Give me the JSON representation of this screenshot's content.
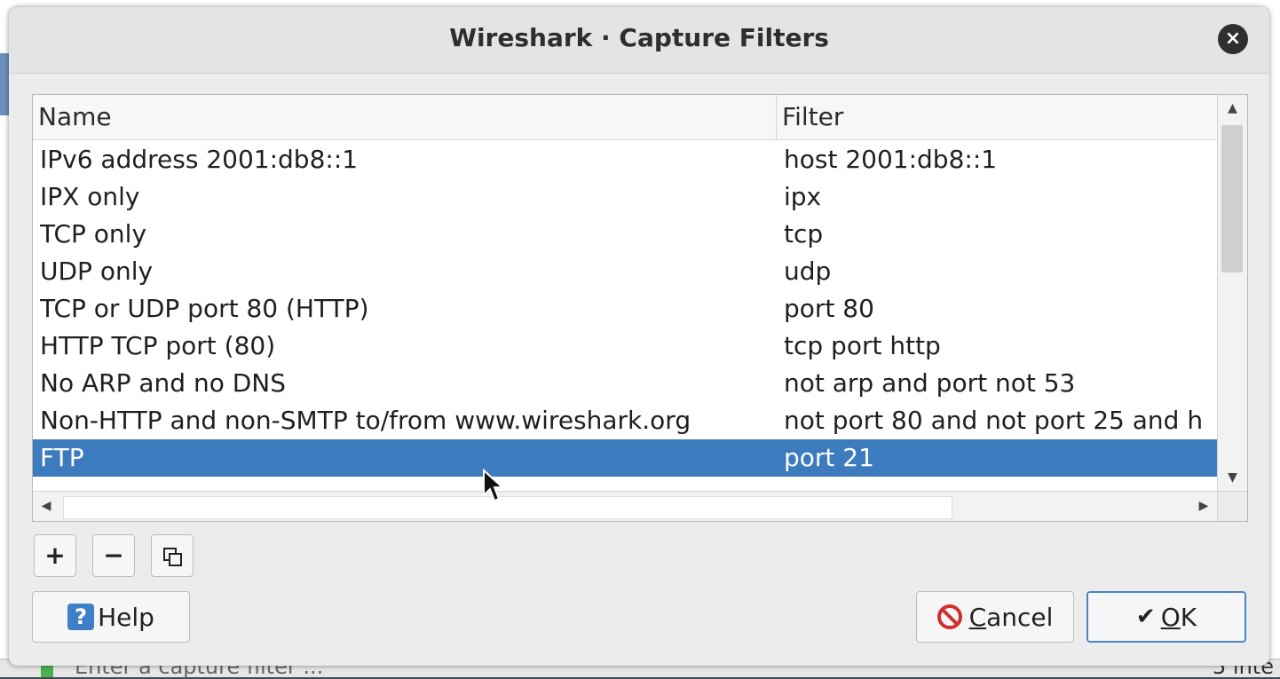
{
  "window": {
    "title": "Wireshark · Capture Filters",
    "close_symbol": "×"
  },
  "table": {
    "columns": [
      "Name",
      "Filter"
    ],
    "rows": [
      {
        "name": "IPv6 address 2001:db8::1",
        "filter": "host 2001:db8::1",
        "selected": false
      },
      {
        "name": "IPX only",
        "filter": "ipx",
        "selected": false
      },
      {
        "name": "TCP only",
        "filter": "tcp",
        "selected": false
      },
      {
        "name": "UDP only",
        "filter": "udp",
        "selected": false
      },
      {
        "name": "TCP or UDP port 80 (HTTP)",
        "filter": "port 80",
        "selected": false
      },
      {
        "name": "HTTP TCP port (80)",
        "filter": "tcp port http",
        "selected": false
      },
      {
        "name": "No ARP and no DNS",
        "filter": "not arp and port not 53",
        "selected": false
      },
      {
        "name": "Non-HTTP and non-SMTP to/from www.wireshark.org",
        "filter": "not port 80 and not port 25 and h",
        "selected": false
      },
      {
        "name": "FTP",
        "filter": "port 21",
        "selected": true
      }
    ]
  },
  "toolbar": {
    "add_label": "+",
    "remove_label": "−"
  },
  "buttons": {
    "help_icon": "?",
    "help_label": "Help",
    "cancel_first": "C",
    "cancel_rest": "ancel",
    "ok_icon": "✔",
    "ok_first": "O",
    "ok_rest": "K"
  },
  "backdrop": {
    "status_hint": "Enter a capture filter ...",
    "status_right": "5 inte"
  },
  "colors": {
    "selection": "#3d7bbf",
    "dialog_bg": "#ececec"
  }
}
